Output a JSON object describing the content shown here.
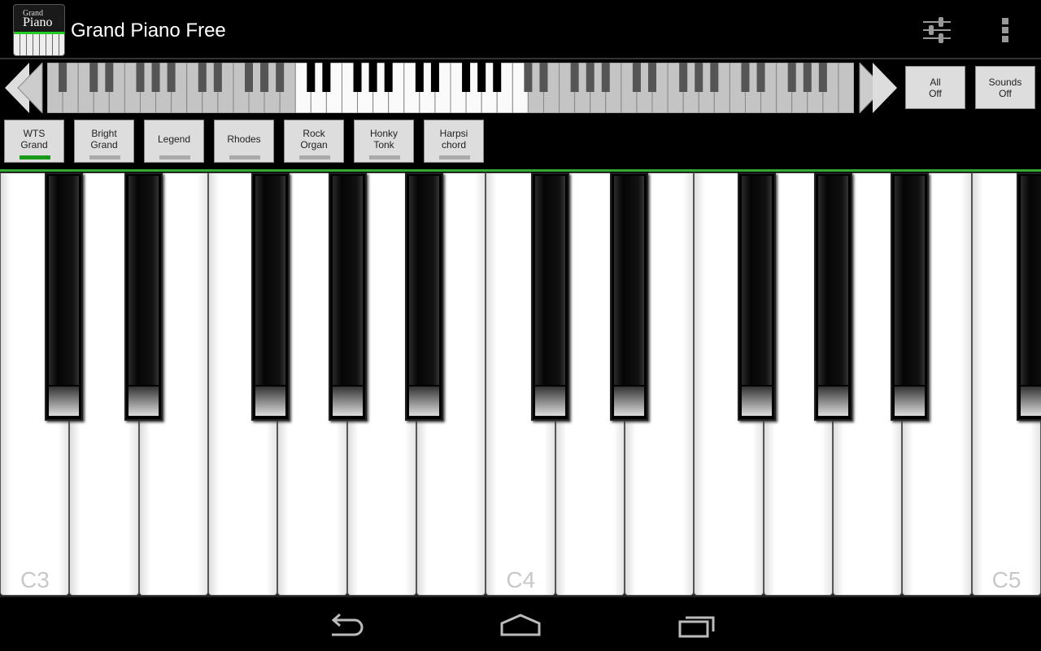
{
  "app": {
    "title": "Grand Piano Free",
    "icon_text_1": "Grand",
    "icon_text_2": "Piano",
    "icon": "app-piano-icon"
  },
  "actions": {
    "settings_icon": "sliders-icon",
    "overflow_icon": "overflow-menu-icon"
  },
  "mini_keyboard": {
    "visible_range": "C3-C5",
    "white_keys": 52
  },
  "buttons": {
    "all_off": "All\nOff",
    "sounds_off": "Sounds\nOff"
  },
  "sounds": [
    {
      "label": "WTS\nGrand",
      "active": true
    },
    {
      "label": "Bright\nGrand",
      "active": false
    },
    {
      "label": "Legend",
      "active": false
    },
    {
      "label": "Rhodes",
      "active": false
    },
    {
      "label": "Rock\nOrgan",
      "active": false
    },
    {
      "label": "Honky\nTonk",
      "active": false
    },
    {
      "label": "Harpsi\nchord",
      "active": false
    }
  ],
  "keyboard": {
    "labels": [
      "C3",
      "C4",
      "C5"
    ]
  },
  "colors": {
    "accent": "#33aa33",
    "active_indicator": "#1a9a1a"
  },
  "navbar": {
    "back": "back-icon",
    "home": "home-icon",
    "recents": "recents-icon"
  }
}
